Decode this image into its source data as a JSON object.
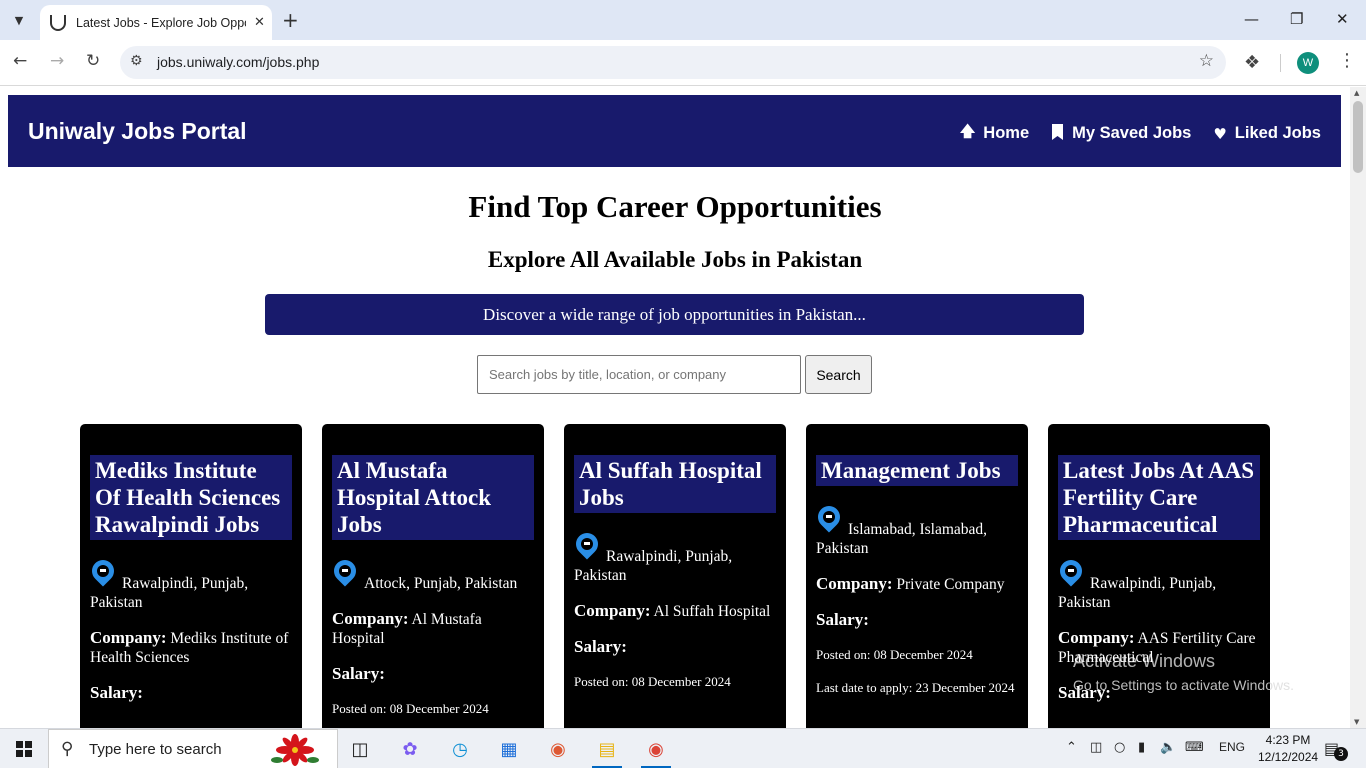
{
  "browser": {
    "tab_title": "Latest Jobs - Explore Job Opportunities",
    "url": "jobs.uniwaly.com/jobs.php",
    "profile_initial": "W"
  },
  "site": {
    "brand": "Uniwaly Jobs Portal",
    "nav": [
      {
        "label": "Home",
        "icon": "arrow-up-icon"
      },
      {
        "label": "My Saved Jobs",
        "icon": "bookmark-icon"
      },
      {
        "label": "Liked Jobs",
        "icon": "heart-icon"
      }
    ],
    "heading": "Find Top Career Opportunities",
    "subheading": "Explore All Available Jobs in Pakistan",
    "banner": "Discover a wide range of job opportunities in Pakistan...",
    "search": {
      "placeholder": "Search jobs by title, location, or company",
      "button": "Search"
    },
    "company_label": "Company:",
    "salary_label": "Salary:",
    "jobs": [
      {
        "title": "Mediks Institute Of Health Sciences Rawalpindi Jobs",
        "location": "Rawalpindi, Punjab, Pakistan",
        "company": "Mediks Institute of Health Sciences",
        "posted": "",
        "last_date": ""
      },
      {
        "title": "Al Mustafa Hospital Attock Jobs",
        "location": "Attock, Punjab, Pakistan",
        "company": "Al Mustafa Hospital",
        "posted": "Posted on: 08 December 2024",
        "last_date": ""
      },
      {
        "title": "Al Suffah Hospital Jobs",
        "location": "Rawalpindi, Punjab, Pakistan",
        "company": "Al Suffah Hospital",
        "posted": "Posted on: 08 December 2024",
        "last_date": ""
      },
      {
        "title": "Management Jobs",
        "location": "Islamabad, Islamabad, Pakistan",
        "company": "Private Company",
        "posted": "Posted on: 08 December 2024",
        "last_date": "Last date to apply: 23 December 2024"
      },
      {
        "title": "Latest Jobs At AAS Fertility Care Pharmaceutical",
        "location": "Rawalpindi, Punjab, Pakistan",
        "company": "AAS Fertility Care Pharmaceutical",
        "posted": "",
        "last_date": ""
      }
    ]
  },
  "watermark": {
    "line1": "Activate Windows",
    "line2": "Go to Settings to activate Windows."
  },
  "taskbar": {
    "search_placeholder": "Type here to search",
    "language": "ENG",
    "time": "4:23 PM",
    "date": "12/12/2024",
    "notification_count": "3"
  },
  "colors": {
    "header_bg": "#181a6c",
    "card_bg": "#000000",
    "pin": "#2a8ee6"
  }
}
